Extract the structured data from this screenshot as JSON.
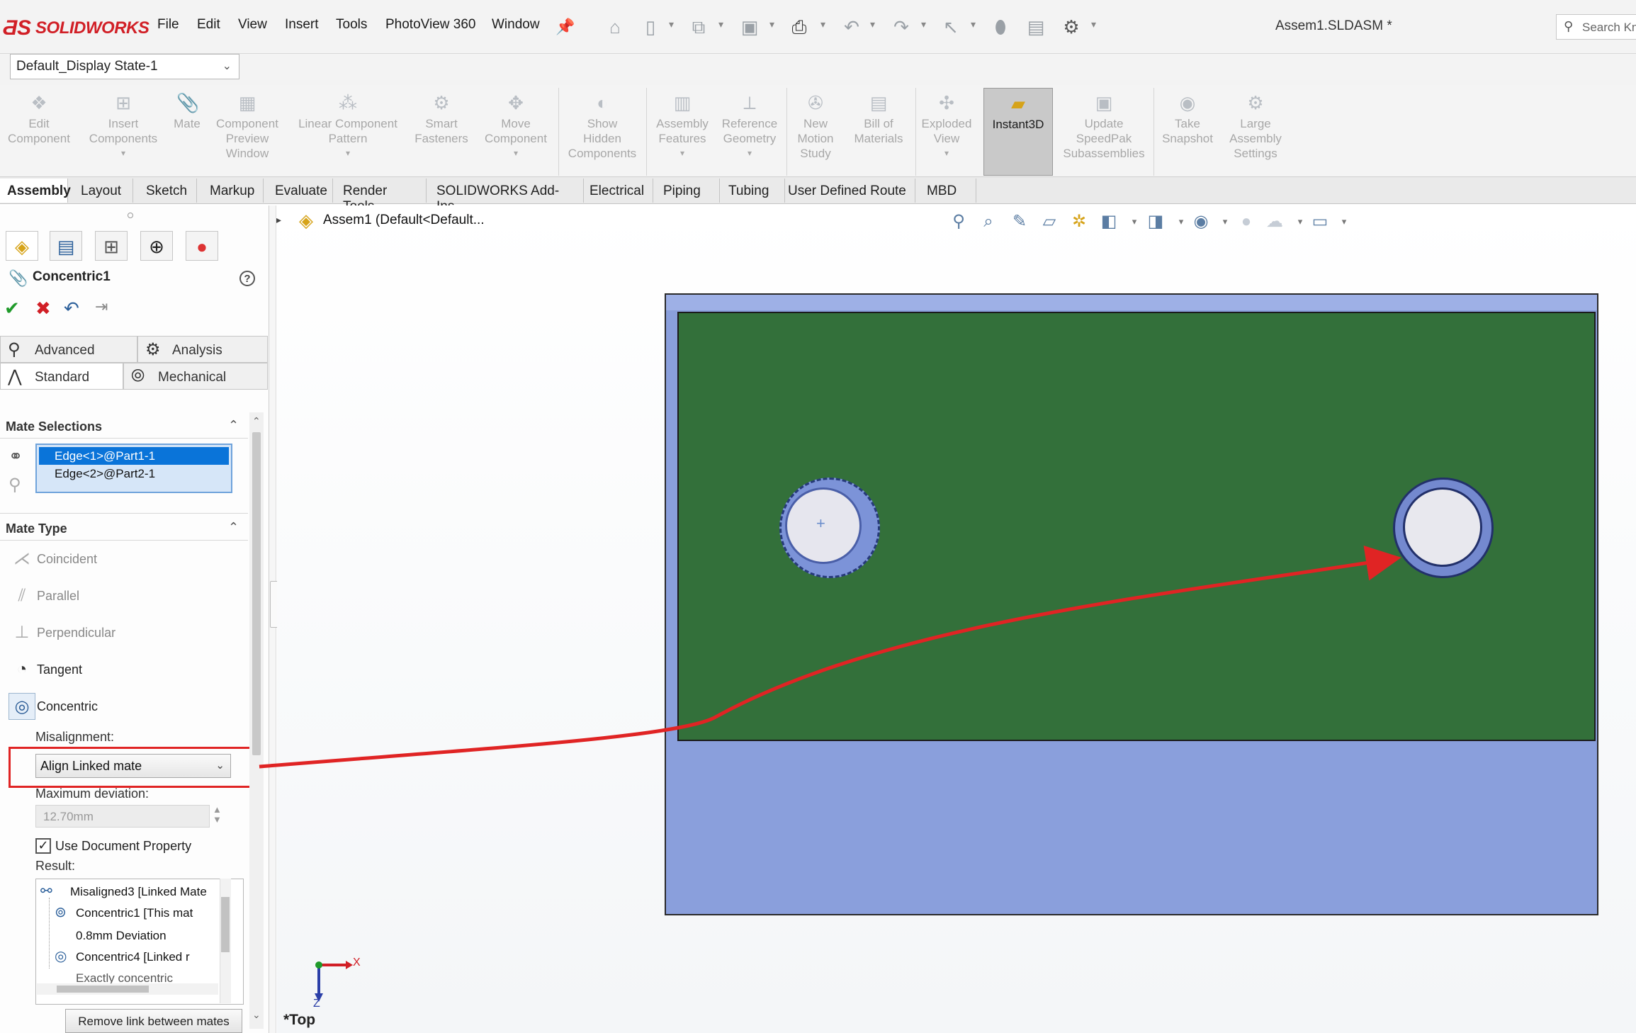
{
  "app": {
    "brand": "SOLIDWORKS",
    "menu": [
      "File",
      "Edit",
      "View",
      "Insert",
      "Tools",
      "PhotoView 360",
      "Window"
    ],
    "document_title": "Assem1.SLDASM *",
    "search_placeholder": "Search Kn"
  },
  "display_state": {
    "value": "Default_Display State-1"
  },
  "command_manager": [
    {
      "label": "Edit\nComponent",
      "icon": "edit-component-icon"
    },
    {
      "label": "Insert\nComponents",
      "icon": "insert-components-icon"
    },
    {
      "label": "Mate",
      "icon": "mate-icon"
    },
    {
      "label": "Component\nPreview\nWindow",
      "icon": "component-preview-icon"
    },
    {
      "label": "Linear Component\nPattern",
      "icon": "linear-pattern-icon"
    },
    {
      "label": "Smart\nFasteners",
      "icon": "smart-fasteners-icon"
    },
    {
      "label": "Move\nComponent",
      "icon": "move-component-icon"
    },
    {
      "label": "Show\nHidden\nComponents",
      "icon": "show-hidden-icon"
    },
    {
      "label": "Assembly\nFeatures",
      "icon": "assembly-features-icon"
    },
    {
      "label": "Reference\nGeometry",
      "icon": "reference-geometry-icon"
    },
    {
      "label": "New\nMotion\nStudy",
      "icon": "motion-study-icon"
    },
    {
      "label": "Bill of\nMaterials",
      "icon": "bom-icon"
    },
    {
      "label": "Exploded\nView",
      "icon": "exploded-view-icon"
    },
    {
      "label": "Instant3D",
      "icon": "instant3d-icon"
    },
    {
      "label": "Update\nSpeedPak\nSubassemblies",
      "icon": "speedpak-icon"
    },
    {
      "label": "Take\nSnapshot",
      "icon": "snapshot-icon"
    },
    {
      "label": "Large\nAssembly\nSettings",
      "icon": "large-assembly-icon"
    }
  ],
  "tabs": [
    "Assembly",
    "Layout",
    "Sketch",
    "Markup",
    "Evaluate",
    "Render Tools",
    "SOLIDWORKS Add-Ins",
    "Electrical",
    "Piping",
    "Tubing",
    "User Defined Route",
    "MBD"
  ],
  "active_tab": "Assembly",
  "property_manager": {
    "title": "Concentric1",
    "subtabs": [
      "Advanced",
      "Analysis",
      "Standard",
      "Mechanical"
    ],
    "mate_selections": {
      "heading": "Mate Selections",
      "items": [
        "Edge<1>@Part1-1",
        "Edge<2>@Part2-1"
      ]
    },
    "mate_type": {
      "heading": "Mate Type",
      "items": [
        "Coincident",
        "Parallel",
        "Perpendicular",
        "Tangent",
        "Concentric"
      ]
    },
    "misalignment_label": "Misalignment:",
    "misalignment_value": "Align Linked mate",
    "max_deviation_label": "Maximum deviation:",
    "max_deviation_value": "12.70mm",
    "use_document_property": "Use Document Property",
    "result_label": "Result:",
    "result_tree": [
      "Misaligned3 [Linked Mate",
      "Concentric1 [This mat",
      "0.8mm Deviation",
      "Concentric4 [Linked r",
      "Exactly concentric"
    ],
    "remove_link_button": "Remove link between mates"
  },
  "viewport": {
    "tree_label": "Assem1  (Default<Default...",
    "view_name": "*Top",
    "axis_x": "X",
    "axis_z": "Z"
  },
  "colors": {
    "plate_green": "#33703a",
    "plate_blue": "#8a9fdc",
    "annotation_red": "#e02424",
    "selection_blue": "#0a74d9"
  }
}
